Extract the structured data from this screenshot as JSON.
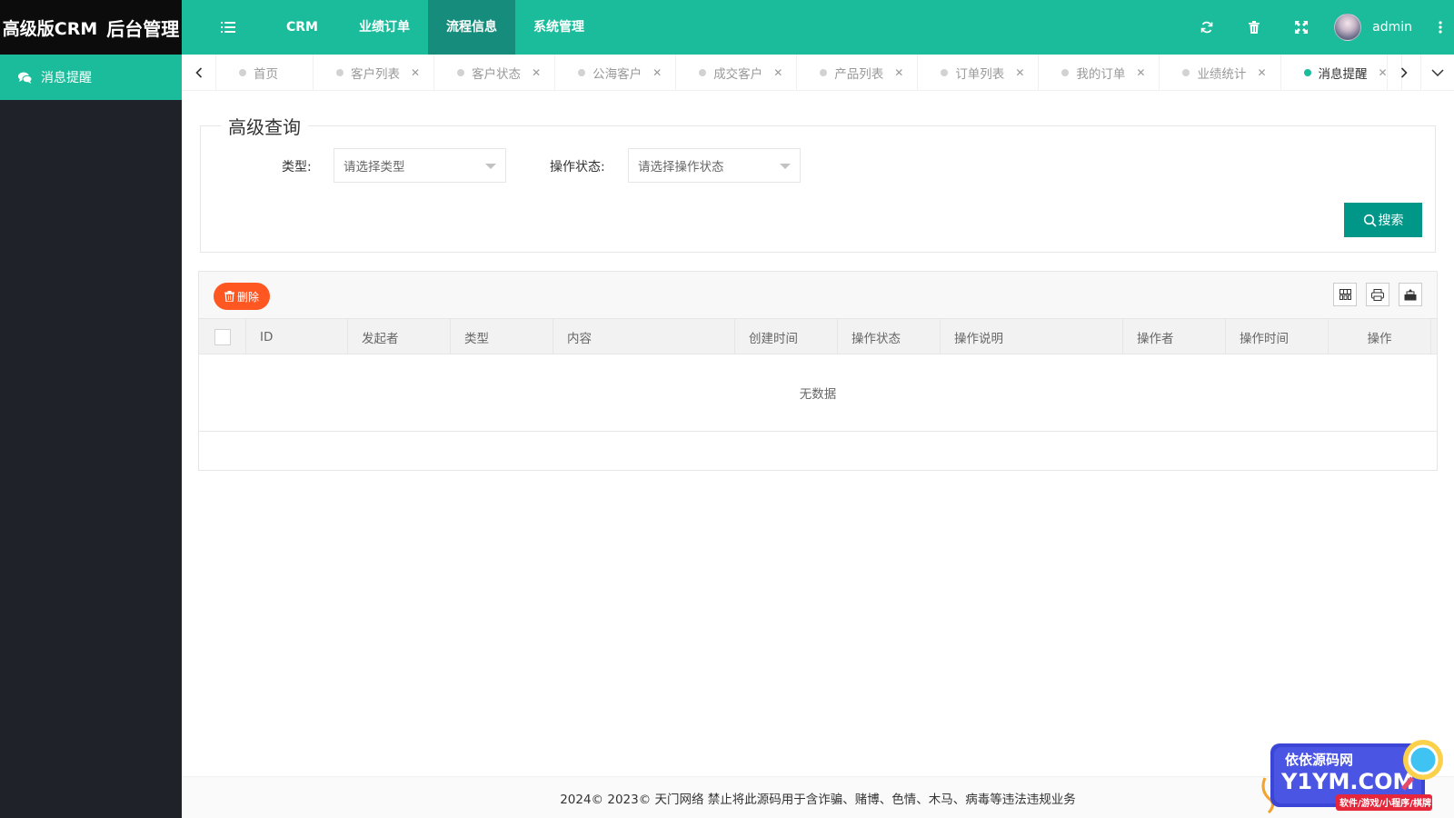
{
  "header": {
    "logo_part1": "高级版CRM",
    "logo_part2": "后台管理",
    "nav": [
      {
        "label": "CRM",
        "active": false
      },
      {
        "label": "业绩订单",
        "active": false
      },
      {
        "label": "流程信息",
        "active": true
      },
      {
        "label": "系统管理",
        "active": false
      }
    ],
    "user_name": "admin",
    "icons": [
      "refresh-icon",
      "trash-icon",
      "fullscreen-icon",
      "more-vertical-icon"
    ]
  },
  "sidebar": {
    "items": [
      {
        "label": "消息提醒",
        "icon": "chat-icon",
        "active": true
      }
    ]
  },
  "tabs": [
    {
      "label": "首页",
      "closable": false,
      "active": false
    },
    {
      "label": "客户列表",
      "closable": true,
      "active": false
    },
    {
      "label": "客户状态",
      "closable": true,
      "active": false
    },
    {
      "label": "公海客户",
      "closable": true,
      "active": false
    },
    {
      "label": "成交客户",
      "closable": true,
      "active": false
    },
    {
      "label": "产品列表",
      "closable": true,
      "active": false
    },
    {
      "label": "订单列表",
      "closable": true,
      "active": false
    },
    {
      "label": "我的订单",
      "closable": true,
      "active": false
    },
    {
      "label": "业绩统计",
      "closable": true,
      "active": false
    },
    {
      "label": "消息提醒",
      "closable": true,
      "active": true
    }
  ],
  "search": {
    "legend": "高级查询",
    "type_label": "类型:",
    "type_placeholder": "请选择类型",
    "status_label": "操作状态:",
    "status_placeholder": "请选择操作状态",
    "search_button": "搜索"
  },
  "table": {
    "delete_button": "删除",
    "columns": [
      "ID",
      "发起者",
      "类型",
      "内容",
      "创建时间",
      "操作状态",
      "操作说明",
      "操作者",
      "操作时间",
      "操作"
    ],
    "empty_text": "无数据",
    "tool_icons": [
      "columns-icon",
      "print-icon",
      "export-icon"
    ]
  },
  "footer": {
    "text": "2024© 2023© 天门网络 禁止将此源码用于含诈骗、赌博、色情、木马、病毒等违法违规业务"
  },
  "watermark": {
    "line1": "依依源码网",
    "line2": "Y1YM.COM",
    "line3": "软件/游戏/小程序/棋牌"
  },
  "colors": {
    "primary": "#1bbc9b",
    "active_nav": "#168d7c",
    "sidebar_bg": "#20222a",
    "logo_bg": "#0c0c0c",
    "search_button": "#009688",
    "delete_button": "#ff5722"
  }
}
